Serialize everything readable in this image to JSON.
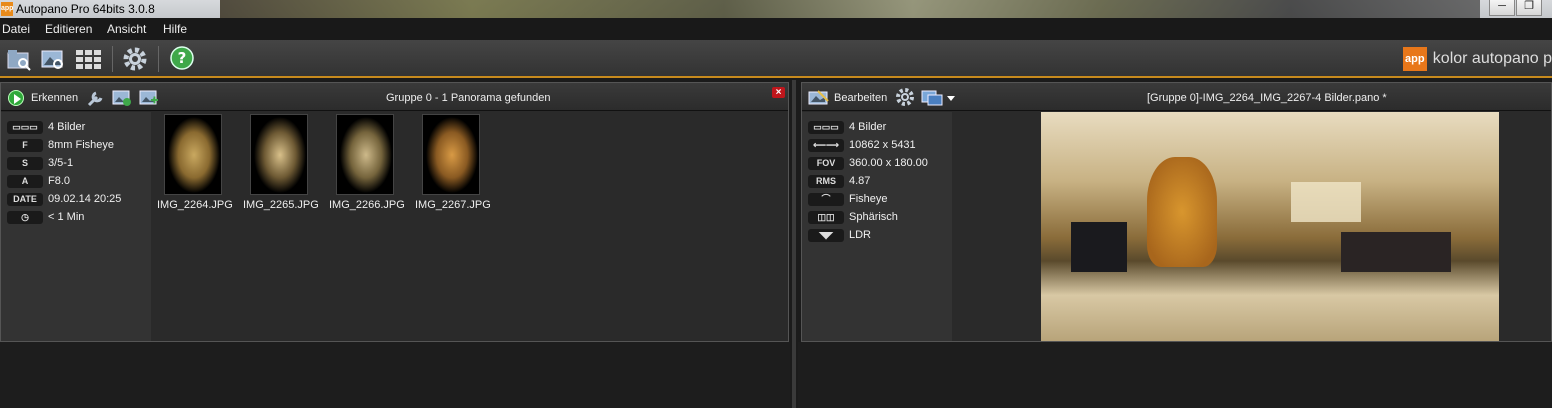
{
  "window": {
    "title": "Autopano Pro 64bits 3.0.8",
    "app_icon_text": "app",
    "minimize": "─",
    "maximize": "❐"
  },
  "menu": [
    "Datei",
    "Editieren",
    "Ansicht",
    "Hilfe"
  ],
  "brand": {
    "logo_text": "app",
    "name": "kolor autopano p"
  },
  "left_panel": {
    "header_title": "Gruppe 0 - 1 Panorama gefunden",
    "detect_label": "Erkennen",
    "close_label": "×",
    "info": [
      {
        "badge": "▭▭▭",
        "text": "4 Bilder"
      },
      {
        "badge": "F",
        "text": "8mm Fisheye"
      },
      {
        "badge": "S",
        "text": "3/5-1"
      },
      {
        "badge": "A",
        "text": "F8.0"
      },
      {
        "badge": "DATE",
        "text": "09.02.14 20:25"
      },
      {
        "badge": "◷",
        "text": "< 1 Min"
      }
    ],
    "images": [
      "IMG_2264.JPG",
      "IMG_2265.JPG",
      "IMG_2266.JPG",
      "IMG_2267.JPG"
    ]
  },
  "right_panel": {
    "header_title": "[Gruppe 0]-IMG_2264_IMG_2267-4 Bilder.pano *",
    "edit_label": "Bearbeiten",
    "info": [
      {
        "badge": "▭▭▭",
        "text": "4 Bilder"
      },
      {
        "badge": "⟵⟶",
        "text": "10862 x 5431"
      },
      {
        "badge": "FOV",
        "text": "360.00 x 180.00"
      },
      {
        "badge": "RMS",
        "text": "4.87"
      },
      {
        "badge": "⌒",
        "text": "Fisheye"
      },
      {
        "badge": "◫◫",
        "text": "Sphärisch"
      },
      {
        "badge": "◥◤",
        "text": "LDR"
      }
    ]
  },
  "colors": {
    "accent": "#c78a1d",
    "panel_bg": "#2a2a2a",
    "close_red": "#c0161c"
  }
}
